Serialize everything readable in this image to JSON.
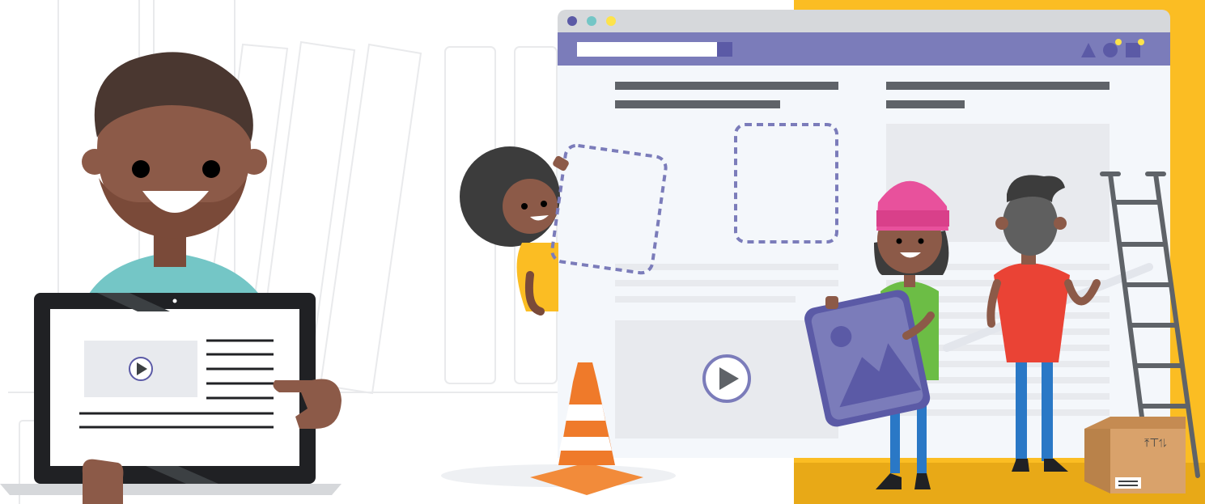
{
  "palette": {
    "nav_purple": "#7b7cba",
    "accent_purple": "#5b5aa6",
    "window_bg": "#f4f7fb",
    "chrome_gray": "#d6d8db",
    "placeholder_gray": "#e8eaee",
    "text_bar_dark": "#5f6368",
    "yellow": "#fbbd23",
    "skin_dark": "#8c5a48",
    "shirt_teal": "#74c6c6",
    "shirt_green": "#6cbd45",
    "shirt_red": "#ea4335",
    "beanie_pink": "#e8519c",
    "cone_orange": "#ef7a2a",
    "box_tan": "#d9a26b"
  },
  "icons": [
    "window-dot-purple-icon",
    "window-dot-teal-icon",
    "window-dot-yellow-icon",
    "triangle-shape-icon",
    "circle-shape-icon",
    "square-shape-icon",
    "play-icon",
    "image-landscape-icon",
    "traffic-cone-icon",
    "cardboard-box-icon",
    "ladder-icon"
  ],
  "box_label": {
    "handling_symbols": "⤒⊤⥮"
  }
}
